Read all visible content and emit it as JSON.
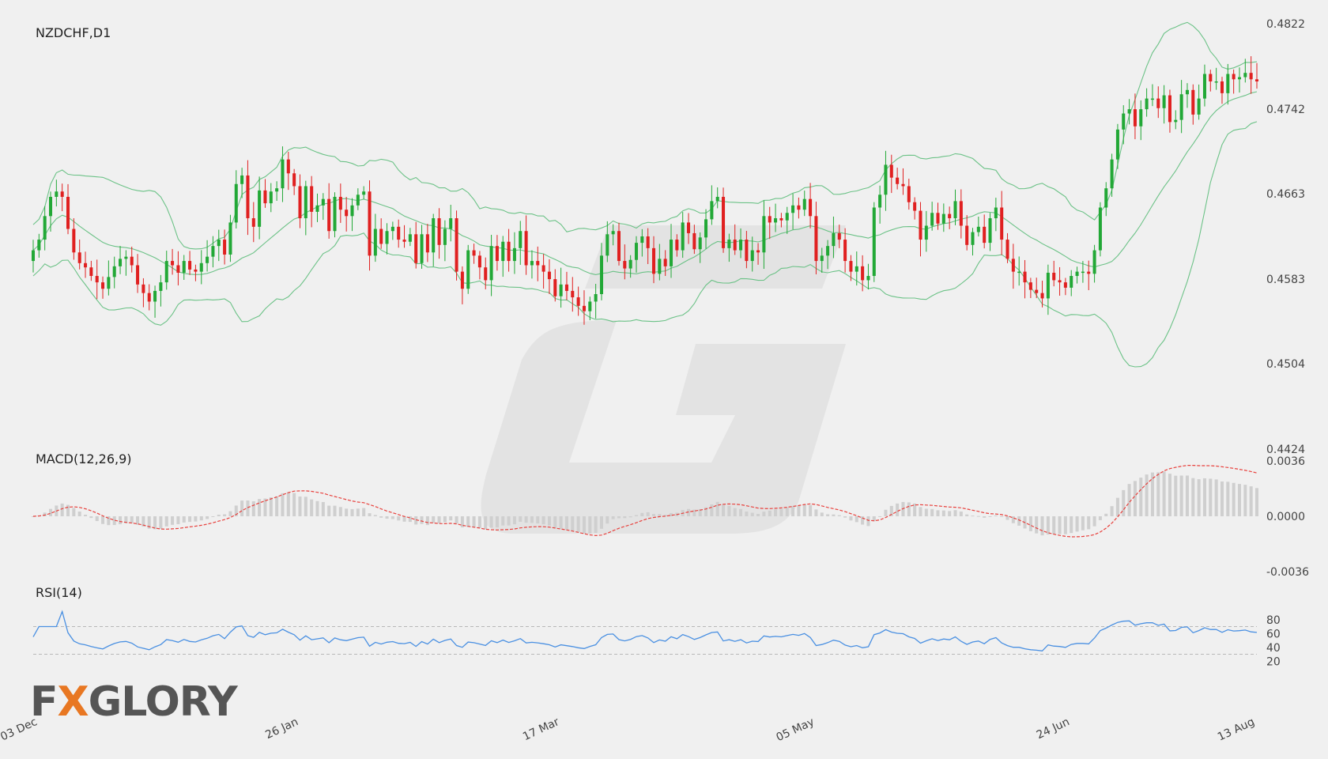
{
  "colors": {
    "background": "#f0f0f0",
    "bull": "#22a836",
    "bear": "#e02020",
    "bands": "#6cc287",
    "macd_hist": "#cfcfcf",
    "macd_signal": "#e8403c",
    "rsi_line": "#4a90e2",
    "rsi_levels": "#b8b8b8",
    "axis_text": "#444444",
    "watermark": "#d9d9d9",
    "logo_accent": "#e87722"
  },
  "logo": {
    "text_pre": "F",
    "text_x": "X",
    "text_post": "GLORY"
  },
  "chart_data": [
    {
      "type": "candlestick",
      "title": "NZDCHF,D1",
      "symbol": "NZDCHF",
      "timeframe": "D1",
      "ylim": [
        0.4424,
        0.4822
      ],
      "yticks": [
        "0.4822",
        "0.4742",
        "0.4663",
        "0.4583",
        "0.4504",
        "0.4424"
      ],
      "xticks": [
        "03 Dec",
        "26 Jan",
        "17 Mar",
        "05 May",
        "24 Jun",
        "13 Aug"
      ],
      "overlays": [
        "Bollinger Bands upper",
        "Bollinger Bands middle",
        "Bollinger Bands lower"
      ],
      "close": [
        0.461,
        0.462,
        0.4642,
        0.466,
        0.4665,
        0.466,
        0.463,
        0.4608,
        0.4598,
        0.4594,
        0.4586,
        0.458,
        0.4574,
        0.4585,
        0.4595,
        0.4602,
        0.4604,
        0.4596,
        0.4578,
        0.457,
        0.4562,
        0.4572,
        0.458,
        0.46,
        0.4596,
        0.4589,
        0.46,
        0.4592,
        0.459,
        0.4598,
        0.4604,
        0.4614,
        0.462,
        0.4606,
        0.4636,
        0.4672,
        0.468,
        0.464,
        0.4632,
        0.4666,
        0.4654,
        0.4665,
        0.4668,
        0.4695,
        0.4682,
        0.467,
        0.464,
        0.467,
        0.4646,
        0.4652,
        0.4658,
        0.4628,
        0.466,
        0.4648,
        0.4642,
        0.4652,
        0.4662,
        0.4665,
        0.4605,
        0.463,
        0.4616,
        0.4628,
        0.4632,
        0.462,
        0.4618,
        0.4625,
        0.4598,
        0.4625,
        0.4608,
        0.464,
        0.4615,
        0.463,
        0.464,
        0.459,
        0.4574,
        0.461,
        0.4605,
        0.4594,
        0.4582,
        0.4614,
        0.46,
        0.4618,
        0.46,
        0.4612,
        0.4628,
        0.4596,
        0.46,
        0.4596,
        0.459,
        0.4583,
        0.4567,
        0.4578,
        0.4572,
        0.4566,
        0.4558,
        0.4553,
        0.4562,
        0.4569,
        0.4605,
        0.4625,
        0.4628,
        0.46,
        0.4593,
        0.4601,
        0.4617,
        0.4623,
        0.4612,
        0.4588,
        0.4602,
        0.4595,
        0.462,
        0.461,
        0.4636,
        0.4626,
        0.4611,
        0.4622,
        0.4639,
        0.4656,
        0.466,
        0.4612,
        0.462,
        0.461,
        0.462,
        0.46,
        0.461,
        0.4608,
        0.4642,
        0.4636,
        0.464,
        0.4638,
        0.4645,
        0.4652,
        0.4648,
        0.4658,
        0.4642,
        0.46,
        0.4605,
        0.4614,
        0.4626,
        0.462,
        0.46,
        0.459,
        0.4595,
        0.4582,
        0.4586,
        0.465,
        0.4662,
        0.469,
        0.4678,
        0.4672,
        0.467,
        0.4655,
        0.4647,
        0.462,
        0.4633,
        0.4645,
        0.4635,
        0.4644,
        0.464,
        0.4656,
        0.4633,
        0.4615,
        0.4627,
        0.4632,
        0.4617,
        0.464,
        0.465,
        0.462,
        0.4602,
        0.459,
        0.459,
        0.458,
        0.4573,
        0.457,
        0.4565,
        0.4589,
        0.4582,
        0.458,
        0.4575,
        0.4586,
        0.459,
        0.459,
        0.4588,
        0.461,
        0.465,
        0.4668,
        0.4695,
        0.4723,
        0.4738,
        0.4742,
        0.4726,
        0.4742,
        0.4752,
        0.4752,
        0.4743,
        0.4755,
        0.473,
        0.4732,
        0.4756,
        0.476,
        0.4737,
        0.4752,
        0.4775,
        0.4768,
        0.4768,
        0.4757,
        0.4775,
        0.477,
        0.4772,
        0.4776,
        0.477,
        0.4768
      ],
      "rsi": {
        "title": "RSI(14)",
        "levels": [
          80,
          60,
          40,
          20
        ],
        "bands": [
          70,
          30
        ],
        "ylim": [
          10,
          90
        ]
      },
      "macd": {
        "title": "MACD(12,26,9)",
        "yticks": [
          "0.0036",
          "0.0000",
          "-0.0036"
        ],
        "ylim": [
          -0.0036,
          0.0036
        ]
      }
    }
  ]
}
